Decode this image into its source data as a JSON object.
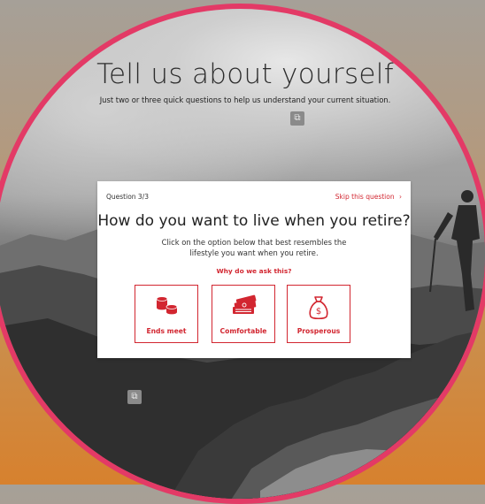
{
  "page": {
    "title": "Tell us about yourself",
    "subtitle": "Just two or three quick questions to help us understand your current situation."
  },
  "card": {
    "question_number": "Question 3/3",
    "skip_label": "Skip this question",
    "skip_icon": "chevron-right-icon",
    "question": "How do you want to live when you retire?",
    "instruction": "Click on the option below that best resembles the lifestyle you want when you retire.",
    "why_label": "Why do we ask this?",
    "options": [
      {
        "label": "Ends meet",
        "icon": "coins-icon"
      },
      {
        "label": "Comfortable",
        "icon": "cash-stack-icon"
      },
      {
        "label": "Prosperous",
        "icon": "money-bag-icon"
      }
    ]
  },
  "colors": {
    "accent": "#d22630",
    "frame_ring": "#e33a66"
  }
}
